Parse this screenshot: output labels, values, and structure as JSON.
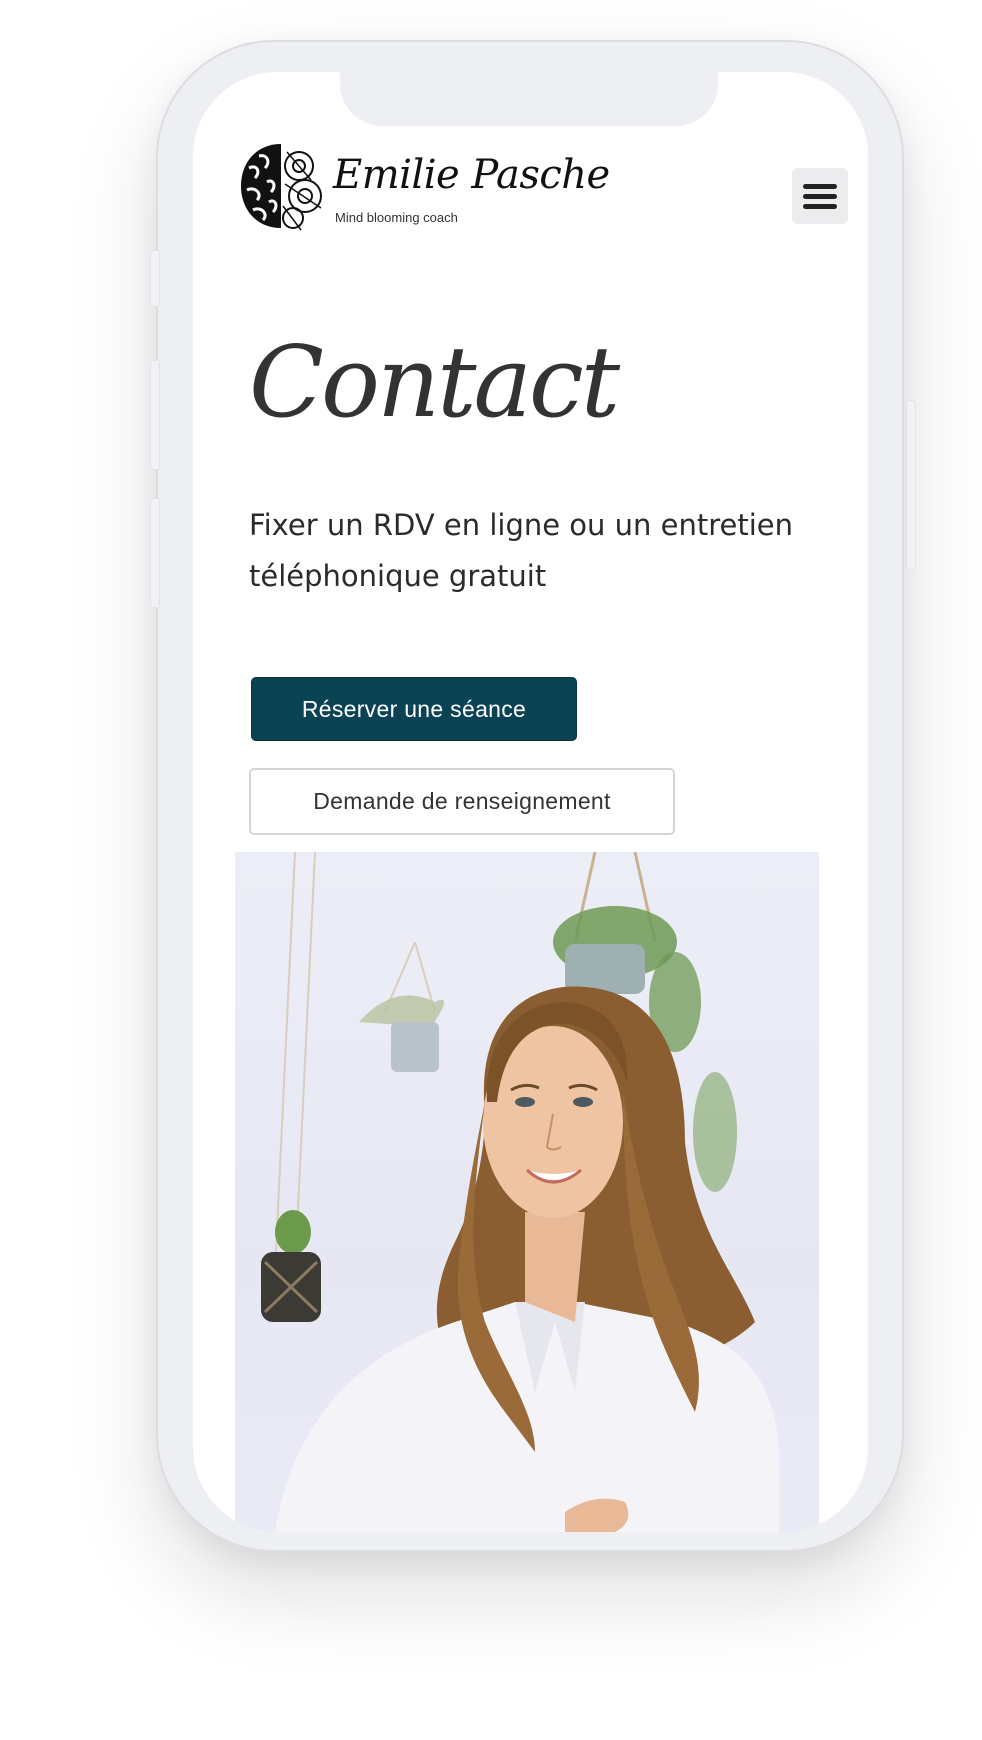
{
  "brand": {
    "name": "Emilie Pasche",
    "tagline": "Mind blooming coach"
  },
  "header": {
    "menu_icon": "hamburger-menu-icon"
  },
  "page": {
    "title": "Contact",
    "intro": "Fixer un RDV en ligne ou un entretien téléphonique gratuit"
  },
  "actions": {
    "primary_label": "Réserver une séance",
    "secondary_label": "Demande de renseignement"
  },
  "colors": {
    "primary_button": "#0c4354",
    "text": "#2b2b2b"
  }
}
